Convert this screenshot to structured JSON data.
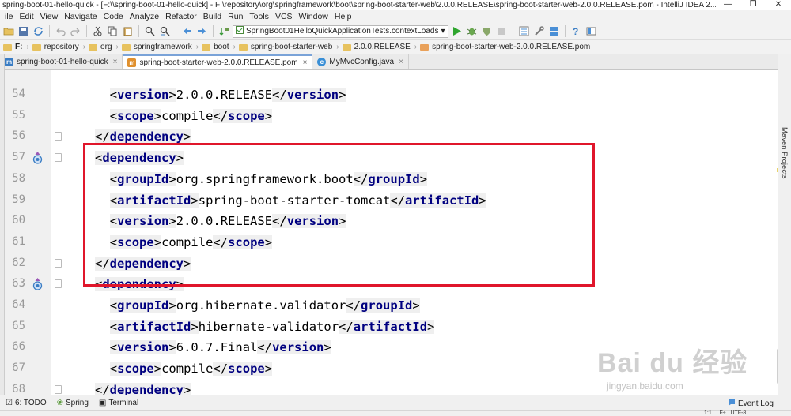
{
  "window": {
    "title": "spring-boot-01-hello-quick - [F:\\\\spring-boot-01-hello-quick] - F:\\repository\\org\\springframework\\boot\\spring-boot-starter-web\\2.0.0.RELEASE\\spring-boot-starter-web-2.0.0.RELEASE.pom - IntelliJ IDEA 2...",
    "minimize": "—",
    "maximize": "❐",
    "close": "✕"
  },
  "menu": [
    "ile",
    "Edit",
    "View",
    "Navigate",
    "Code",
    "Analyze",
    "Refactor",
    "Build",
    "Run",
    "Tools",
    "VCS",
    "Window",
    "Help"
  ],
  "toolbar": {
    "run_config": "SpringBoot01HelloQuickApplicationTests.contextLoads",
    "run_config_arrow": "▾"
  },
  "breadcrumbs": [
    "F:",
    "repository",
    "org",
    "springframework",
    "boot",
    "spring-boot-starter-web",
    "2.0.0.RELEASE",
    "spring-boot-starter-web-2.0.0.RELEASE.pom"
  ],
  "tabs": [
    {
      "label": "spring-boot-01-hello-quick",
      "icon": "m",
      "close": "×"
    },
    {
      "label": "spring-boot-starter-web-2.0.0.RELEASE.pom",
      "icon": "m",
      "close": "×"
    },
    {
      "label": "MyMvcConfig.java",
      "icon": "c",
      "close": "×"
    }
  ],
  "side_panel": {
    "maven_projects": "Maven Projects"
  },
  "code": [
    {
      "ln": "54",
      "indent": 2,
      "open": "version",
      "text": "2.0.0.RELEASE",
      "close": "version"
    },
    {
      "ln": "55",
      "indent": 2,
      "open": "scope",
      "text": "compile",
      "close": "scope"
    },
    {
      "ln": "56",
      "indent": 1,
      "endtag": "dependency"
    },
    {
      "ln": "57",
      "indent": 1,
      "open": "dependency"
    },
    {
      "ln": "58",
      "indent": 2,
      "open": "groupId",
      "text": "org.springframework.boot",
      "close": "groupId"
    },
    {
      "ln": "59",
      "indent": 2,
      "open": "artifactId",
      "text": "spring-boot-starter-tomcat",
      "close": "artifactId"
    },
    {
      "ln": "60",
      "indent": 2,
      "open": "version",
      "text": "2.0.0.RELEASE",
      "close": "version"
    },
    {
      "ln": "61",
      "indent": 2,
      "open": "scope",
      "text": "compile",
      "close": "scope"
    },
    {
      "ln": "62",
      "indent": 1,
      "endtag": "dependency"
    },
    {
      "ln": "63",
      "indent": 1,
      "open": "dependency"
    },
    {
      "ln": "64",
      "indent": 2,
      "open": "groupId",
      "text": "org.hibernate.validator",
      "close": "groupId"
    },
    {
      "ln": "65",
      "indent": 2,
      "open": "artifactId",
      "text": "hibernate-validator",
      "close": "artifactId"
    },
    {
      "ln": "66",
      "indent": 2,
      "open": "version",
      "text": "6.0.7.Final",
      "close": "version"
    },
    {
      "ln": "67",
      "indent": 2,
      "open": "scope",
      "text": "compile",
      "close": "scope"
    },
    {
      "ln": "68",
      "indent": 1,
      "endtag": "dependency"
    }
  ],
  "tool_windows": [
    {
      "label": "6: TODO",
      "icon": "☑"
    },
    {
      "label": "Spring",
      "icon": "❀"
    },
    {
      "label": "Terminal",
      "icon": "▣"
    }
  ],
  "event_log": "Event Log",
  "status": {
    "position": "1:1",
    "line_sep": "LF÷",
    "encoding": "UTF-8"
  },
  "watermark": {
    "main": "Bai du 经验",
    "sub": "jingyan.baidu.com"
  },
  "colors": {
    "tag": "#000080",
    "highlight_box": "#e0162b",
    "tab_accent": "#7aa3d8"
  }
}
